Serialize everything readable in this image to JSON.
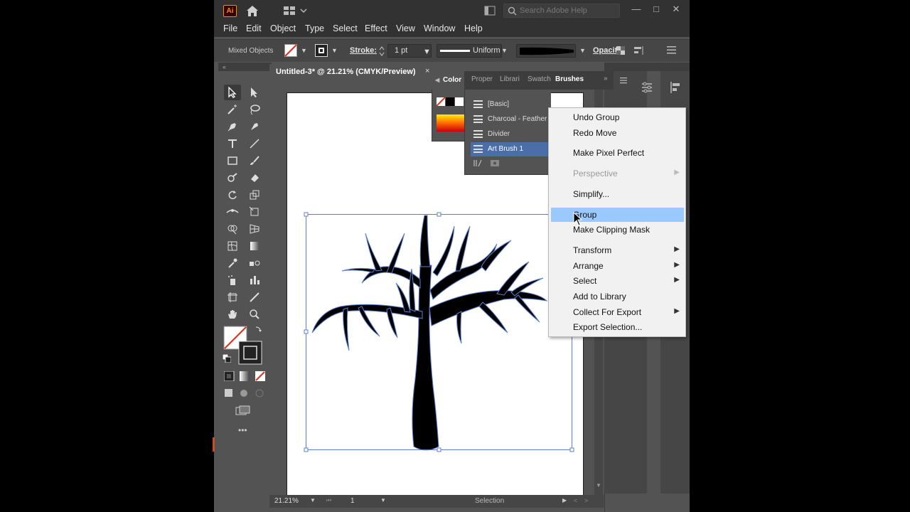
{
  "app": {
    "logo_text": "Ai",
    "accent": "#ff8a00"
  },
  "titlebar": {
    "search_placeholder": "Search Adobe Help"
  },
  "menubar": {
    "items": [
      "File",
      "Edit",
      "Object",
      "Type",
      "Select",
      "Effect",
      "View",
      "Window",
      "Help"
    ]
  },
  "controlbar": {
    "selection_label": "Mixed Objects",
    "stroke_label": "Stroke:",
    "stroke_weight": "1 pt",
    "profile_label": "Uniform",
    "opacity_label": "Opacity"
  },
  "document": {
    "tab_title": "Untitled-3* @ 21.21% (CMYK/Preview)",
    "close": "×"
  },
  "panels": {
    "tabs": [
      "Color",
      "Proper",
      "Librari",
      "Swatch",
      "Brushes"
    ],
    "active_tab": "Brushes",
    "brushes": [
      "[Basic]",
      "Charcoal - Feather",
      "Divider",
      "Art Brush 1"
    ],
    "selected_brush": "Art Brush 1"
  },
  "context_menu": {
    "items": [
      {
        "label": "Undo Group",
        "submenu": false,
        "disabled": false
      },
      {
        "label": "Redo Move",
        "submenu": false,
        "disabled": false
      },
      {
        "label": "Make Pixel Perfect",
        "submenu": false,
        "disabled": false
      },
      {
        "label": "Perspective",
        "submenu": true,
        "disabled": true
      },
      {
        "label": "Simplify...",
        "submenu": false,
        "disabled": false
      },
      {
        "label": "Group",
        "submenu": false,
        "disabled": false,
        "highlighted": true
      },
      {
        "label": "Make Clipping Mask",
        "submenu": false,
        "disabled": false
      },
      {
        "label": "Transform",
        "submenu": true,
        "disabled": false
      },
      {
        "label": "Arrange",
        "submenu": true,
        "disabled": false
      },
      {
        "label": "Select",
        "submenu": true,
        "disabled": false
      },
      {
        "label": "Add to Library",
        "submenu": false,
        "disabled": false
      },
      {
        "label": "Collect For Export",
        "submenu": true,
        "disabled": false
      },
      {
        "label": "Export Selection...",
        "submenu": false,
        "disabled": false
      }
    ]
  },
  "statusbar": {
    "zoom": "21.21%",
    "page": "1",
    "tool": "Selection"
  }
}
